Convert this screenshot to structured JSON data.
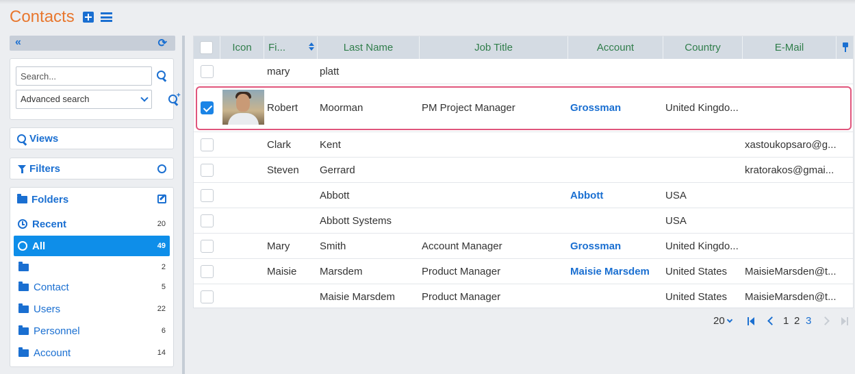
{
  "header": {
    "title": "Contacts"
  },
  "sidebar": {
    "search_placeholder": "Search...",
    "advanced_search": "Advanced search",
    "views_label": "Views",
    "filters_label": "Filters",
    "folders_label": "Folders",
    "folders": [
      {
        "label": "Recent",
        "count": "20"
      },
      {
        "label": "All",
        "count": "49"
      },
      {
        "label": "",
        "count": "2"
      },
      {
        "label": "Contact",
        "count": "5"
      },
      {
        "label": "Users",
        "count": "22"
      },
      {
        "label": "Personnel",
        "count": "6"
      },
      {
        "label": "Account",
        "count": "14"
      }
    ]
  },
  "grid": {
    "columns": {
      "icon": "Icon",
      "first": "Fi...",
      "last": "Last Name",
      "job": "Job Title",
      "account": "Account",
      "country": "Country",
      "email": "E-Mail"
    },
    "rows": [
      {
        "first": "mary",
        "last": "platt",
        "job": "",
        "account": "",
        "country": "",
        "email": ""
      },
      {
        "first": "Robert",
        "last": "Moorman",
        "job": "PM Project Manager",
        "account": "Grossman",
        "country": "United Kingdo...",
        "email": ""
      },
      {
        "first": "Clark",
        "last": "Kent",
        "job": "",
        "account": "",
        "country": "",
        "email": "xastoukopsaro@g..."
      },
      {
        "first": "Steven",
        "last": "Gerrard",
        "job": "",
        "account": "",
        "country": "",
        "email": "kratorakos@gmai..."
      },
      {
        "first": "",
        "last": "Abbott",
        "job": "",
        "account": "Abbott",
        "country": "USA",
        "email": ""
      },
      {
        "first": "",
        "last": "Abbott Systems",
        "job": "",
        "account": "",
        "country": "USA",
        "email": ""
      },
      {
        "first": "Mary",
        "last": "Smith",
        "job": "Account Manager",
        "account": "Grossman",
        "country": "United Kingdo...",
        "email": ""
      },
      {
        "first": "Maisie",
        "last": "Marsdem",
        "job": "Product Manager",
        "account": "Maisie Marsdem",
        "country": "United States",
        "email": "MaisieMarsden@t..."
      },
      {
        "first": "",
        "last": "Maisie Marsdem",
        "job": "Product Manager",
        "account": "",
        "country": "United States",
        "email": "MaisieMarsden@t..."
      }
    ]
  },
  "pager": {
    "page_size": "20",
    "pages": [
      "1",
      "2",
      "3"
    ],
    "current_page": "3"
  },
  "colors": {
    "accent": "#1a6fd1",
    "title": "#e8772e",
    "active_folder": "#0e8ee9",
    "selection_outline": "#e0557c"
  }
}
